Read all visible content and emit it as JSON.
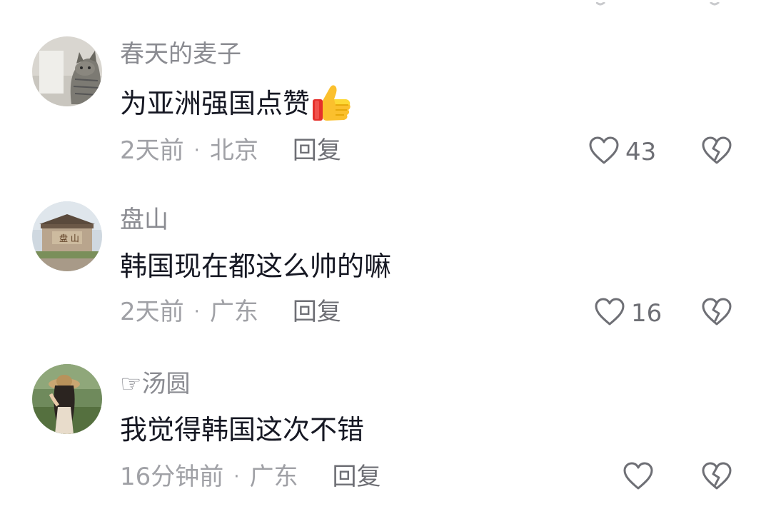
{
  "comments": [
    {
      "username": "春天的麦子",
      "text": "为亚洲强国点赞",
      "emoji": "thumbs-up",
      "time": "2天前",
      "location": "北京",
      "reply_label": "回复",
      "likes": "43"
    },
    {
      "username": "盘山",
      "text": "韩国现在都这么帅的嘛",
      "time": "2天前",
      "location": "广东",
      "reply_label": "回复",
      "likes": "16"
    },
    {
      "username": "☞汤圆",
      "text": "我觉得韩国这次不错",
      "time": "16分钟前",
      "location": "广东",
      "reply_label": "回复",
      "likes": ""
    }
  ],
  "separator": "·",
  "icons": {
    "like": "heart-outline-icon",
    "dislike": "broken-heart-icon",
    "emoji": "thumbs-up-emoji"
  },
  "colors": {
    "text_primary": "#161823",
    "text_secondary": "#8a8b91",
    "icon": "#6e6f75",
    "background": "#ffffff"
  }
}
